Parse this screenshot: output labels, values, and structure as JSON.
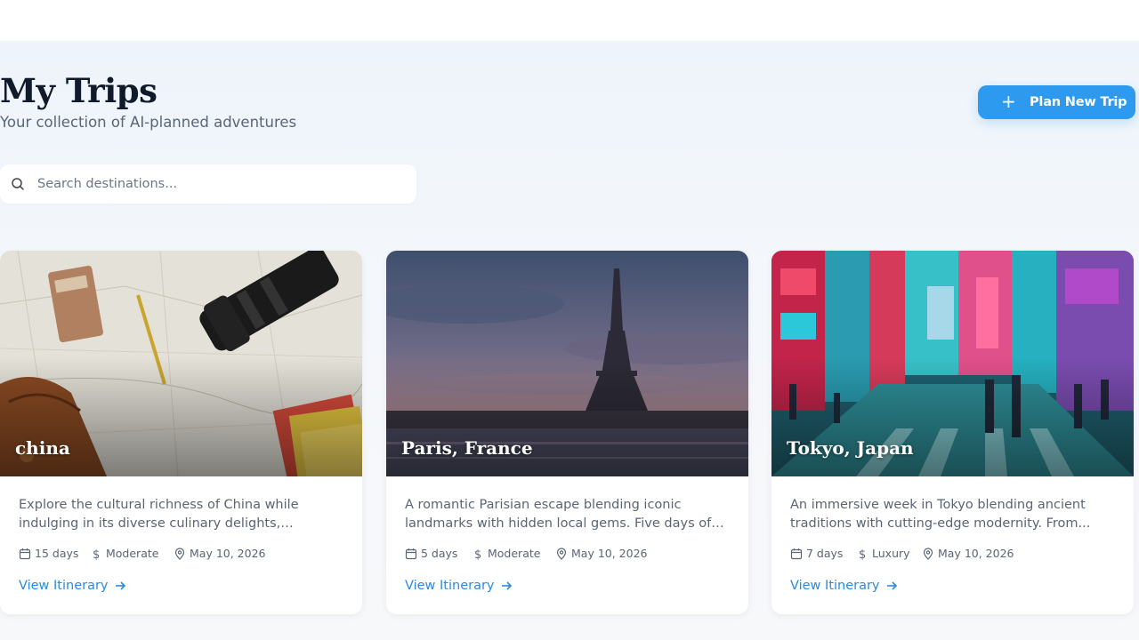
{
  "header": {
    "title": "My Trips",
    "subtitle": "Your collection of AI-planned adventures",
    "plan_button_label": "Plan New Trip",
    "plan_button_icon": "plus-icon"
  },
  "search": {
    "placeholder": "Search destinations...",
    "value": "",
    "icon": "search-icon"
  },
  "colors": {
    "accent": "#2d9af0",
    "link": "#2e8ad8",
    "title": "#101a2b"
  },
  "trips": [
    {
      "name": "china",
      "description": "Explore the cultural richness of China while indulging in its diverse culinary delights, adventurous offering...",
      "duration": "15 days",
      "budget": "Moderate",
      "date": "May 10, 2026",
      "link_label": "View Itinerary"
    },
    {
      "name": "Paris, France",
      "description": "A romantic Parisian escape blending iconic landmarks with hidden local gems. Five days of art,...",
      "duration": "5 days",
      "budget": "Moderate",
      "date": "May 10, 2026",
      "link_label": "View Itinerary"
    },
    {
      "name": "Tokyo, Japan",
      "description": "An immersive week in Tokyo blending ancient traditions with cutting-edge modernity. From...",
      "duration": "7 days",
      "budget": "Luxury",
      "date": "May 10, 2026",
      "link_label": "View Itinerary"
    }
  ]
}
